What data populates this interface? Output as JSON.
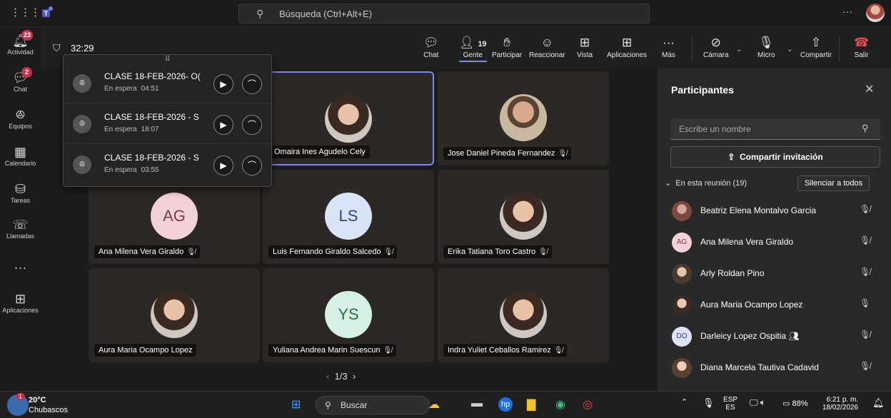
{
  "colors": {
    "accent": "#7f85f5",
    "badge": "#c4314b",
    "leave": "#e44e4e"
  },
  "search": {
    "placeholder": "Búsqueda (Ctrl+Alt+E)"
  },
  "rail": [
    {
      "label": "Actividad",
      "badge": "23",
      "icon": "bell-icon"
    },
    {
      "label": "Chat",
      "badge": "2",
      "icon": "chat-icon"
    },
    {
      "label": "Equipos",
      "badge": "",
      "icon": "teams-icon"
    },
    {
      "label": "Calendario",
      "badge": "",
      "icon": "calendar-icon"
    },
    {
      "label": "Tareas",
      "badge": "",
      "icon": "tasks-icon"
    },
    {
      "label": "Llamadas",
      "badge": "",
      "icon": "phone-icon"
    },
    {
      "label": "Aplicaciones",
      "badge": "",
      "icon": "apps-icon"
    }
  ],
  "meeting": {
    "timer": "32:29",
    "toolbar": {
      "chat": "Chat",
      "people": "Gente",
      "people_count": "19",
      "raise": "Participar",
      "react": "Reaccionar",
      "view": "Vista",
      "apps": "Aplicaciones",
      "more": "Más",
      "camera": "Cámara",
      "mic": "Micro",
      "share": "Compartir",
      "leave": "Salir"
    }
  },
  "waiting_calls": [
    {
      "title": "CLASE 18-FEB-2026- O(",
      "status": "En espera",
      "time": "04:51"
    },
    {
      "title": "CLASE 18-FEB-2026 - S",
      "status": "En espera",
      "time": "18:07"
    },
    {
      "title": "CLASE 18-FEB-2026 - S",
      "status": "En espera",
      "time": "03:55"
    }
  ],
  "tiles": [
    {
      "name": "Omaira Ines Agudelo Cely",
      "initials": "",
      "muted": false
    },
    {
      "name": "Jose Daniel Pineda Fernandez",
      "initials": "",
      "muted": true
    },
    {
      "name": "Ana Milena Vera Giraldo",
      "initials": "AG",
      "muted": true
    },
    {
      "name": "Luis Fernando Giraldo Salcedo",
      "initials": "LS",
      "muted": true
    },
    {
      "name": "Erika Tatiana Toro Castro",
      "initials": "",
      "muted": true
    },
    {
      "name": "Aura Maria Ocampo Lopez",
      "initials": "",
      "muted": false
    },
    {
      "name": "Yuliana Andrea Marin Suescun",
      "initials": "YS",
      "muted": true
    },
    {
      "name": "Indra Yuliet Ceballos Ramirez",
      "initials": "",
      "muted": true
    }
  ],
  "pager": "1/3",
  "panel": {
    "title": "Participantes",
    "search_placeholder": "Escribe un nombre",
    "share_invite": "Compartir invitación",
    "section": "En esta reunión (19)",
    "mute_all": "Silenciar a todos",
    "participants": [
      {
        "name": "Beatriz Elena Montalvo Garcia",
        "initials": "",
        "mic": "muted"
      },
      {
        "name": "Ana Milena Vera Giraldo",
        "initials": "AG",
        "mic": "muted"
      },
      {
        "name": "Arly Roldan Pino",
        "initials": "",
        "mic": "muted"
      },
      {
        "name": "Aura Maria Ocampo Lopez",
        "initials": "",
        "mic": "on"
      },
      {
        "name": "Darleicy Lopez Ospitia",
        "initials": "DO",
        "mic": "muted"
      },
      {
        "name": "Diana Marcela Tautiva Cadavid",
        "initials": "",
        "mic": "muted"
      }
    ]
  },
  "taskbar": {
    "weather_badge": "1",
    "temp": "20°C",
    "condition": "Chubascos",
    "search": "Buscar",
    "lang": "ESP",
    "lang2": "ES",
    "battery": "88%",
    "time": "6:21 p. m.",
    "date": "18/02/2026"
  }
}
